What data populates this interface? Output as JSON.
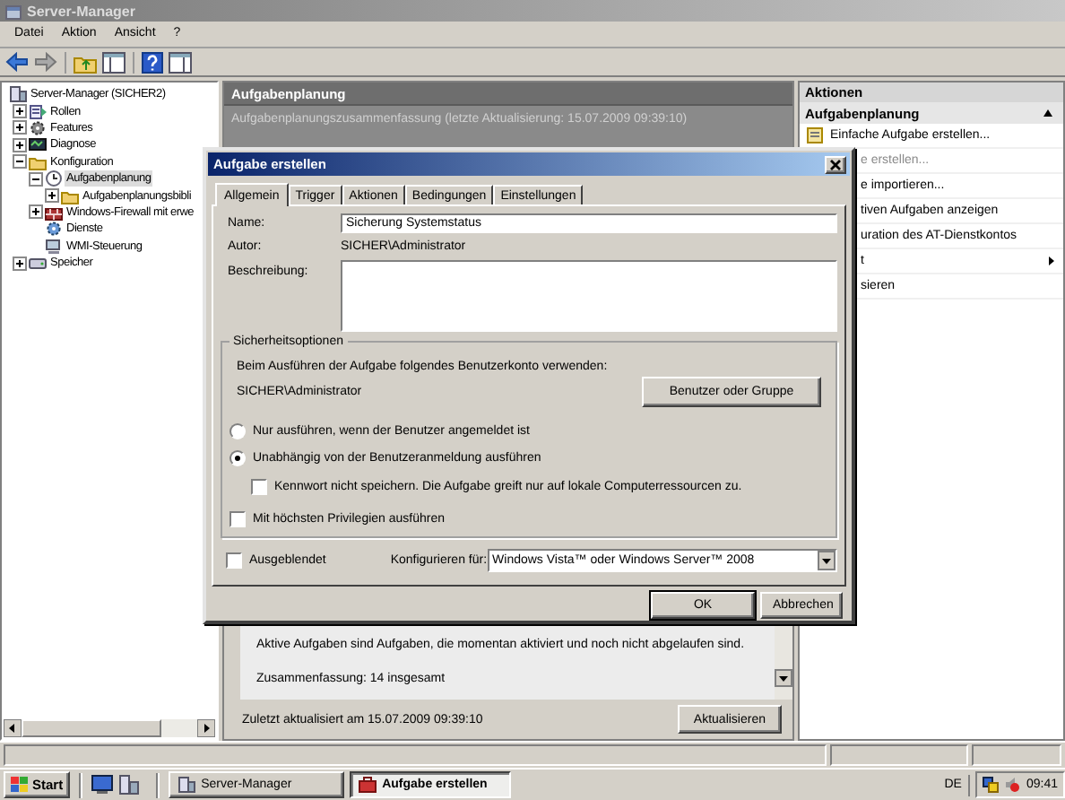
{
  "window": {
    "title": "Server-Manager"
  },
  "menu": [
    "Datei",
    "Aktion",
    "Ansicht",
    "?"
  ],
  "tree": [
    {
      "label": "Server-Manager (SICHER2)",
      "selected": false,
      "children": [
        {
          "label": "Rollen",
          "expanded": false,
          "selected": false
        },
        {
          "label": "Features",
          "expanded": false,
          "selected": false
        },
        {
          "label": "Diagnose",
          "expanded": false,
          "selected": false
        },
        {
          "label": "Konfiguration",
          "expanded": true,
          "selected": false,
          "children": [
            {
              "label": "Aufgabenplanung",
              "expanded": true,
              "selected": true,
              "children": [
                {
                  "label": "Aufgabenplanungsbibli",
                  "expanded": false,
                  "selected": false
                }
              ]
            },
            {
              "label": "Windows-Firewall mit erwe",
              "expanded": false,
              "selected": false
            },
            {
              "label": "Dienste",
              "selected": false
            },
            {
              "label": "WMI-Steuerung",
              "selected": false
            }
          ]
        },
        {
          "label": "Speicher",
          "expanded": false,
          "selected": false
        }
      ]
    }
  ],
  "center": {
    "title": "Aufgabenplanung",
    "subtitle": "Aufgabenplanungszusammenfassung (letzte Aktualisierung: 15.07.2009 09:39:10)",
    "lines": [
      "Aktive Aufgaben sind Aufgaben, die momentan aktiviert und noch nicht abgelaufen sind.",
      "Zusammenfassung: 14 insgesamt"
    ],
    "footer": "Zuletzt aktualisiert am 15.07.2009 09:39:10",
    "refresh_button": "Aktualisieren"
  },
  "actions": {
    "title": "Aktionen",
    "section": {
      "title": "Aufgabenplanung",
      "expanded": true
    },
    "items": [
      {
        "label": "Einfache Aufgabe erstellen...",
        "kind": "full",
        "disabled": false,
        "submenu": false
      },
      {
        "label": "e erstellen...",
        "kind": "clipped",
        "disabled": true,
        "submenu": false
      },
      {
        "label": "e importieren...",
        "kind": "clipped",
        "disabled": false,
        "submenu": false
      },
      {
        "label": "tiven Aufgaben anzeigen",
        "kind": "clipped",
        "disabled": false,
        "submenu": false
      },
      {
        "label": "uration des AT-Dienstkontos",
        "kind": "clipped",
        "disabled": false,
        "submenu": false
      },
      {
        "label": "t",
        "kind": "clipped",
        "disabled": false,
        "submenu": true
      },
      {
        "label": "sieren",
        "kind": "clipped",
        "disabled": false,
        "submenu": false
      }
    ]
  },
  "dialog": {
    "title": "Aufgabe erstellen",
    "tabs": [
      {
        "label": "Allgemein",
        "selected": true
      },
      {
        "label": "Trigger",
        "selected": false
      },
      {
        "label": "Aktionen",
        "selected": false
      },
      {
        "label": "Bedingungen",
        "selected": false
      },
      {
        "label": "Einstellungen",
        "selected": false
      }
    ],
    "name_label": "Name:",
    "name": "Sicherung Systemstatus",
    "author_label": "Autor:",
    "author": "SICHER\\Administrator",
    "description_label": "Beschreibung:",
    "security": {
      "title": "Sicherheitsoptionen",
      "account_prompt": "Beim Ausführen der Aufgabe folgendes Benutzerkonto verwenden:",
      "account": "SICHER\\Administrator",
      "user_button": "Benutzer oder Gruppe",
      "run_modes": [
        {
          "label": "Nur ausführen, wenn der Benutzer angemeldet ist",
          "selected": false
        },
        {
          "label": "Unabhängig von der Benutzeranmeldung ausführen",
          "selected": true,
          "children": [
            {
              "label": "Kennwort nicht speichern. Die Aufgabe greift nur auf lokale Computerressourcen zu.",
              "checked": false
            }
          ]
        }
      ],
      "highest_privileges": {
        "label": "Mit höchsten Privilegien ausführen",
        "checked": false
      }
    },
    "hidden": {
      "label": "Ausgeblendet",
      "checked": false
    },
    "configure_label": "Konfigurieren für:",
    "configure_value": "Windows Vista™ oder Windows Server™ 2008",
    "buttons": [
      {
        "label": "OK",
        "default": true
      },
      {
        "label": "Abbrechen",
        "default": false
      }
    ]
  },
  "taskbar": {
    "start": "Start",
    "tasks": [
      {
        "label": "Server-Manager",
        "selected": false
      },
      {
        "label": "Aufgabe erstellen",
        "selected": true
      }
    ],
    "language": "DE",
    "clock": "09:41"
  }
}
